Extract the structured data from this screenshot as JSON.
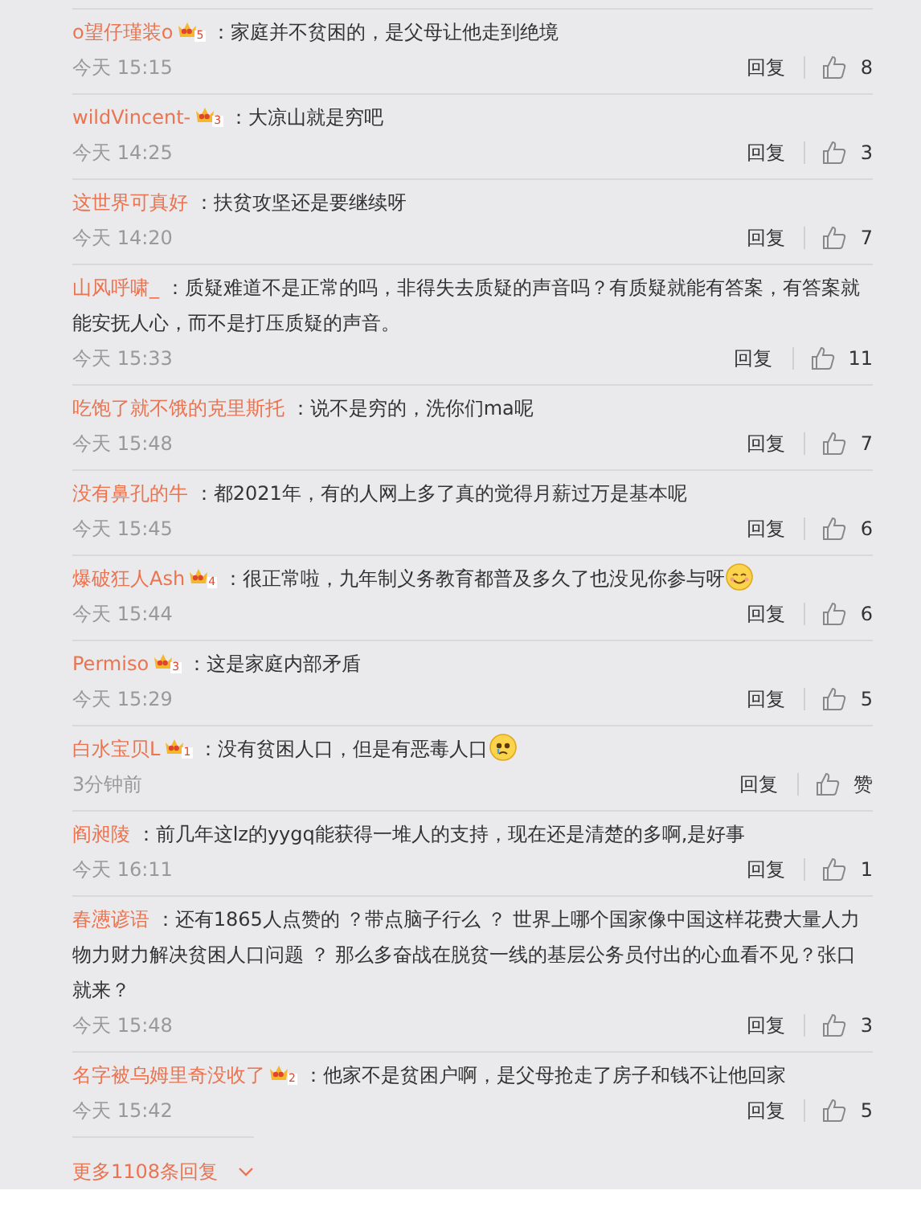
{
  "comments": [
    {
      "user": "o望仔瑾装o",
      "badge": "5",
      "kind": "plain",
      "text": "：家庭并不贫困的，是父母让他走到绝境",
      "time": "今天 15:15",
      "reply": "回复",
      "likes": "8"
    },
    {
      "user": "wildVincent-",
      "badge": "3",
      "kind": "plain",
      "text": "：大凉山就是穷吧",
      "time": "今天 14:25",
      "reply": "回复",
      "likes": "3"
    },
    {
      "user": "这世界可真好",
      "kind": "plain",
      "text": "：扶贫攻坚还是要继续呀",
      "time": "今天 14:20",
      "reply": "回复",
      "likes": "7"
    },
    {
      "user": "山风呼啸_",
      "kind": "plain",
      "text": "：质疑难道不是正常的吗，非得失去质疑的声音吗？有质疑就能有答案，有答案就能安抚人心，而不是打压质疑的声音。",
      "time": "今天 15:33",
      "reply": "回复",
      "likes": "11"
    },
    {
      "user": "吃饱了就不饿的克里斯托",
      "kind": "plain",
      "text": "：说不是穷的，洗你们ma呢",
      "time": "今天 15:48",
      "reply": "回复",
      "likes": "7"
    },
    {
      "user": "没有鼻孔的牛",
      "kind": "plain",
      "text": "：都2021年，有的人网上多了真的觉得月薪过万是基本呢",
      "time": "今天 15:45",
      "reply": "回复",
      "likes": "6"
    },
    {
      "user": "爆破狂人Ash",
      "badge": "4",
      "kind": "smile",
      "text": "：很正常啦，九年制义务教育都普及多久了也没见你参与呀",
      "time": "今天 15:44",
      "reply": "回复",
      "likes": "6"
    },
    {
      "user": "Permiso",
      "badge": "3",
      "kind": "plain",
      "text": "：这是家庭内部矛盾",
      "time": "今天 15:29",
      "reply": "回复",
      "likes": "5"
    },
    {
      "user": "白水宝贝L",
      "badge": "1",
      "kind": "sad",
      "text": "：没有贫困人口，但是有恶毒人口",
      "time": "3分钟前",
      "reply": "回复",
      "likes": "赞"
    },
    {
      "user": "阎昶陵",
      "kind": "plain",
      "text": "：前几年这lz的yygq能获得一堆人的支持，现在还是清楚的多啊,是好事",
      "time": "今天 16:11",
      "reply": "回复",
      "likes": "1"
    },
    {
      "user": "春懑谚语",
      "kind": "plain",
      "text": "：还有1865人点赞的 ？带点脑子行么 ？ 世界上哪个国家像中国这样花费大量人力物力财力解决贫困人口问题 ？ 那么多奋战在脱贫一线的基层公务员付出的心血看不见？张口就来？",
      "time": "今天 15:48",
      "reply": "回复",
      "likes": "3"
    },
    {
      "user": "名字被乌姆里奇没收了",
      "badge": "2",
      "kind": "plain",
      "text": "：他家不是贫困户啊，是父母抢走了房子和钱不让他回家",
      "time": "今天 15:42",
      "reply": "回复",
      "likes": "5"
    }
  ],
  "more": "更多1108条回复"
}
